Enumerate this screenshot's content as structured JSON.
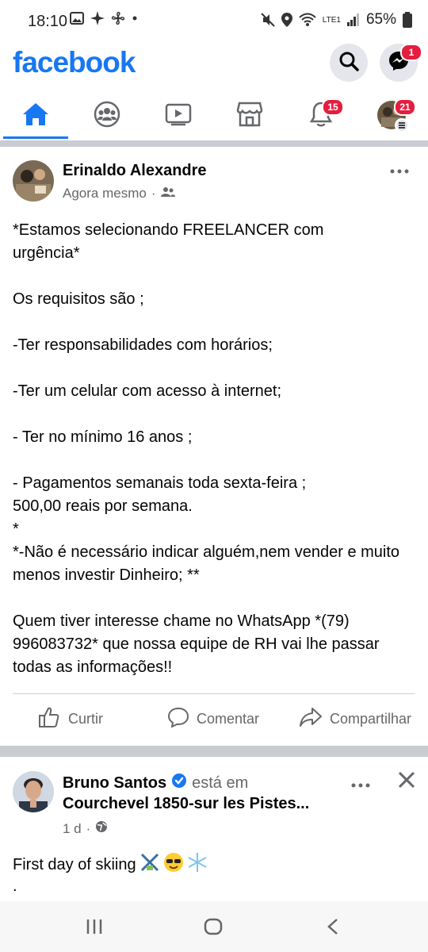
{
  "status_bar": {
    "time": "18:10",
    "battery": "65%",
    "network": "LTE1"
  },
  "header": {
    "logo": "facebook",
    "messenger_badge": "1"
  },
  "tabs": {
    "items": [
      {
        "name": "home",
        "icon": "home-icon",
        "active": true
      },
      {
        "name": "groups",
        "icon": "groups-icon"
      },
      {
        "name": "watch",
        "icon": "video-icon"
      },
      {
        "name": "marketplace",
        "icon": "store-icon"
      },
      {
        "name": "notifications",
        "icon": "bell-icon",
        "badge": "15"
      },
      {
        "name": "menu",
        "icon": "profile-menu-icon",
        "badge": "21"
      }
    ]
  },
  "post1": {
    "author": "Erinaldo Alexandre",
    "time": "Agora mesmo",
    "lines": [
      "*Estamos selecionando FREELANCER com urgência*",
      "",
      "Os requisitos são ;",
      "",
      "-Ter responsabilidades com horários;",
      "",
      "-Ter um celular com acesso à internet;",
      "",
      "- Ter no mínimo 16 anos ;",
      "",
      "- Pagamentos semanais toda sexta-feira ;",
      "500,00 reais por semana.",
      "*",
      "*-Não é necessário indicar alguém,nem vender e muito menos investir Dinheiro; **",
      "",
      "Quem tiver interesse chame no WhatsApp *(79) 996083732* que nossa equipe de RH vai lhe passar todas as informações!!"
    ],
    "actions": {
      "like": "Curtir",
      "comment": "Comentar",
      "share": "Compartilhar"
    }
  },
  "post2": {
    "author": "Bruno Santos",
    "verb": "está em",
    "place": "Courchevel 1850-sur les Pistes...",
    "time": "1 d",
    "text": "First day of skiing",
    "text2": "."
  },
  "colors": {
    "brand": "#1877f2",
    "badge": "#e41e3f",
    "muted": "#65676b"
  }
}
